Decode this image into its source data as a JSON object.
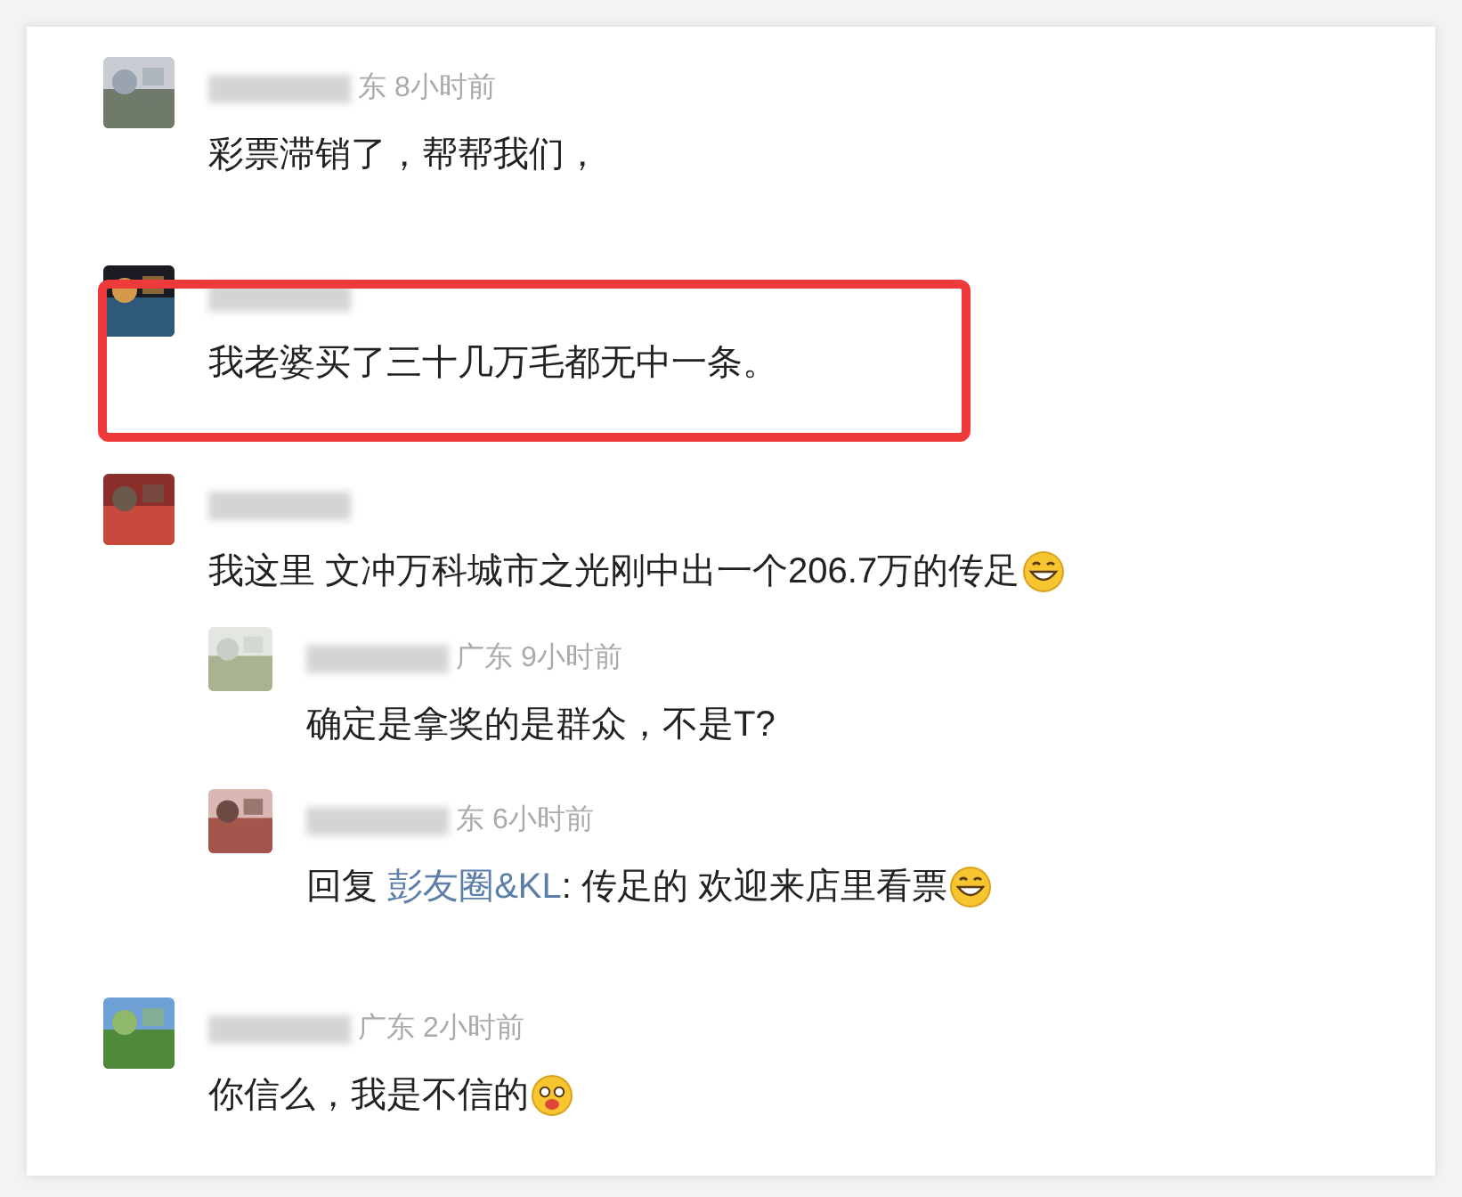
{
  "comments": [
    {
      "meta": "东 8小时前",
      "parts": [
        {
          "kind": "text",
          "text": "彩票滞销了，帮帮我们，"
        }
      ],
      "highlighted": false
    },
    {
      "parts": [
        {
          "kind": "text",
          "text": "我老婆买了三十几万毛都无中一条。"
        }
      ],
      "highlighted": true
    },
    {
      "parts": [
        {
          "kind": "text",
          "text": "我这里 文冲万科城市之光刚中出一个206.7万的传足"
        },
        {
          "kind": "grin"
        }
      ],
      "highlighted": false,
      "replies": [
        {
          "meta": "广东 9小时前",
          "parts": [
            {
              "kind": "text",
              "text": "确定是拿奖的是群众，不是T?"
            }
          ]
        },
        {
          "meta": "东 6小时前",
          "prefix": "回复",
          "mention": "彭友圈&KL",
          "parts": [
            {
              "kind": "text",
              "text": ": 传足的 欢迎来店里看票"
            },
            {
              "kind": "grin"
            }
          ]
        }
      ]
    },
    {
      "meta": "广东 2小时前",
      "parts": [
        {
          "kind": "text",
          "text": "你信么，我是不信的"
        },
        {
          "kind": "flushed"
        }
      ],
      "highlighted": false
    }
  ]
}
